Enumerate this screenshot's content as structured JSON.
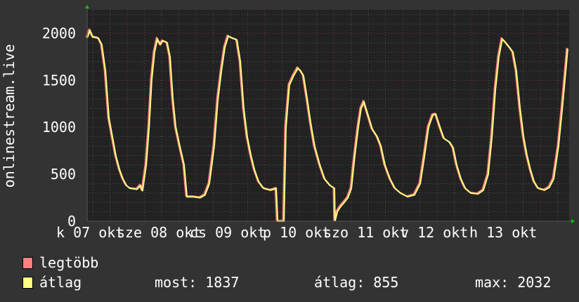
{
  "chart_data": {
    "type": "line",
    "ylabel": "onlinestream.live",
    "xlabel": "",
    "x_unit": "hours since 07 okt 00:00",
    "xlim": [
      10,
      178
    ],
    "ylim": [
      0,
      2250
    ],
    "y_ticks": [
      0,
      500,
      1000,
      1500,
      2000
    ],
    "y_tick_labels": [
      "0",
      "500",
      "1000",
      "1500",
      "2000"
    ],
    "x_tick_labels": [
      "k 07 okt",
      "sze 08 okt",
      "cs 09 okt",
      "p 10 okt",
      "szo 11 okt",
      "v 12 okt",
      "h 13 okt"
    ],
    "x_tick_positions": [
      12,
      36,
      60,
      84,
      108,
      132,
      156
    ],
    "grid": true,
    "series": [
      {
        "name": "legtöbb",
        "color": "#ff8080"
      },
      {
        "name": "átlag",
        "color": "#ffff80",
        "x": [
          10.0,
          11.0,
          12.0,
          13.9,
          15.1,
          16.4,
          17.6,
          18.8,
          20.0,
          21.3,
          22.5,
          23.7,
          24.9,
          27.4,
          28.6,
          29.3,
          30.6,
          31.6,
          32.5,
          33.5,
          34.5,
          35.5,
          36.4,
          37.9,
          38.9,
          39.9,
          40.9,
          42.3,
          43.8,
          44.8,
          47.0,
          49.4,
          51.1,
          52.6,
          54.3,
          55.6,
          56.8,
          58.0,
          59.2,
          60.4,
          62.2,
          63.4,
          64.6,
          65.8,
          67.1,
          68.3,
          69.8,
          71.5,
          73.9,
          75.1,
          75.9,
          76.4,
          78.6,
          79.3,
          80.5,
          82.0,
          83.5,
          84.4,
          85.4,
          86.7,
          87.9,
          89.3,
          91.1,
          92.8,
          94.7,
          96.2,
          96.4,
          97.2,
          98.2,
          99.6,
          100.9,
          102.1,
          103.3,
          104.5,
          105.5,
          106.5,
          107.7,
          109.4,
          111.1,
          112.4,
          113.8,
          115.6,
          117.3,
          119.2,
          121.7,
          124.1,
          126.1,
          127.6,
          129.0,
          130.5,
          131.5,
          133.0,
          134.4,
          136.4,
          137.6,
          138.8,
          140.3,
          141.8,
          143.7,
          146.2,
          148.1,
          149.8,
          151.1,
          152.3,
          153.5,
          154.7,
          155.9,
          157.2,
          158.4,
          159.6,
          160.9,
          162.1,
          163.3,
          164.5,
          165.8,
          167.2,
          169.4,
          171.1,
          172.6,
          174.3,
          175.6,
          176.8,
          177.5
        ],
        "y": [
          1950,
          2030,
          1960,
          1950,
          1880,
          1600,
          1100,
          900,
          700,
          550,
          450,
          380,
          350,
          340,
          380,
          320,
          600,
          1000,
          1500,
          1800,
          1940,
          1880,
          1920,
          1900,
          1750,
          1300,
          1000,
          800,
          600,
          260,
          260,
          250,
          280,
          400,
          800,
          1300,
          1600,
          1850,
          1970,
          1950,
          1930,
          1700,
          1200,
          900,
          700,
          550,
          420,
          350,
          330,
          340,
          350,
          0,
          0,
          1000,
          1450,
          1550,
          1630,
          1600,
          1550,
          1300,
          1050,
          800,
          600,
          450,
          380,
          350,
          0,
          100,
          150,
          200,
          250,
          350,
          700,
          1000,
          1200,
          1270,
          1150,
          980,
          900,
          800,
          600,
          450,
          350,
          300,
          260,
          280,
          400,
          700,
          1000,
          1130,
          1140,
          1000,
          880,
          840,
          780,
          600,
          450,
          350,
          300,
          290,
          330,
          500,
          900,
          1400,
          1750,
          1940,
          1900,
          1850,
          1800,
          1600,
          1200,
          900,
          700,
          550,
          420,
          350,
          330,
          360,
          450,
          800,
          1200,
          1600,
          1837
        ]
      }
    ]
  },
  "legend": {
    "max_label": "legtöbb",
    "avg_label": "átlag",
    "now": "most: 1837",
    "average": "átlag: 855",
    "maximum": "max: 2032"
  },
  "colors": {
    "background": "#333333",
    "plot": "#222222",
    "max": "#ff8080",
    "avg": "#ffff80",
    "grid_minor": "#555555",
    "grid_major": "#803333",
    "arrow": "#00cc00"
  }
}
